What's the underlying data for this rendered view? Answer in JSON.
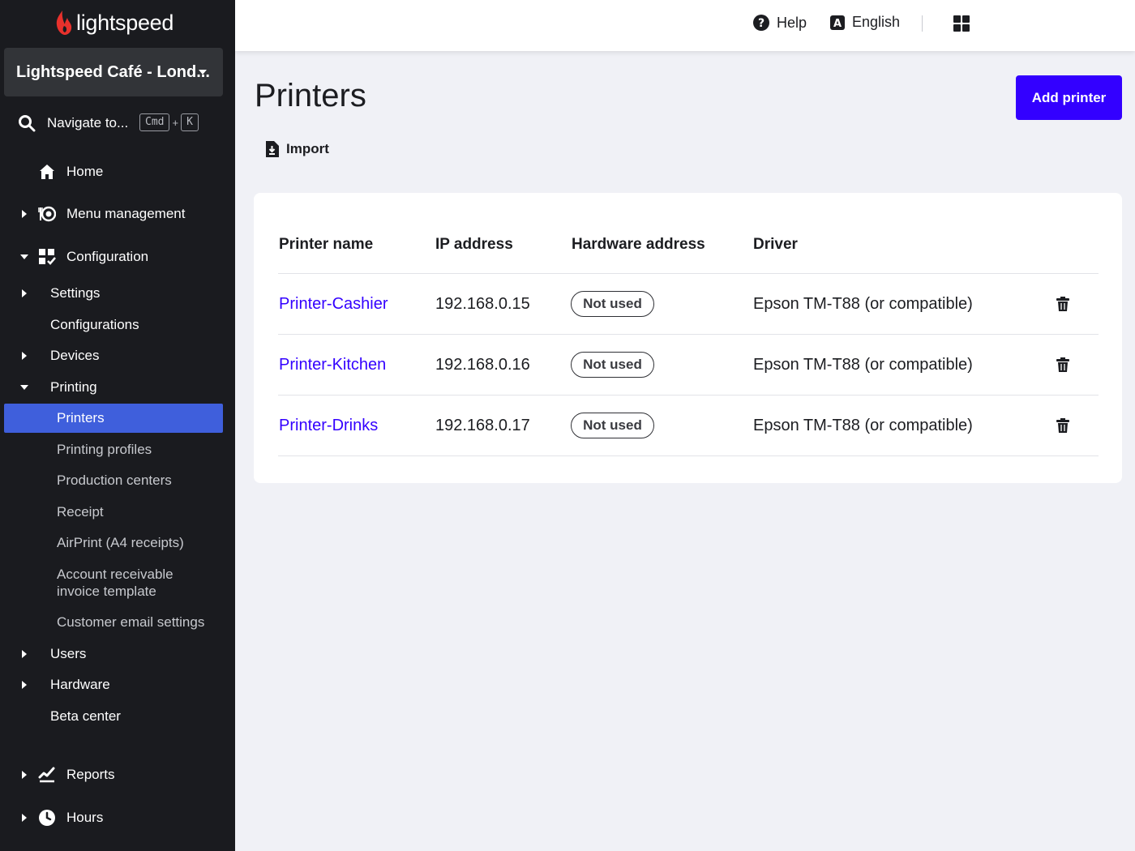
{
  "sidebar": {
    "logo_text": "lightspeed",
    "store_name": "Lightspeed Café - Lond...",
    "navigate_label": "Navigate to...",
    "shortcut_keys": [
      "Cmd",
      "K"
    ],
    "shortcut_plus": "+",
    "items": {
      "home": "Home",
      "menu_management": "Menu management",
      "configuration": "Configuration",
      "settings": "Settings",
      "configurations": "Configurations",
      "devices": "Devices",
      "printing": "Printing",
      "printers": "Printers",
      "printing_profiles": "Printing profiles",
      "production_centers": "Production centers",
      "receipt": "Receipt",
      "airprint": "AirPrint (A4 receipts)",
      "account_receivable_1": "Account receivable",
      "account_receivable_2": "invoice template",
      "customer_email": "Customer email settings",
      "users": "Users",
      "hardware": "Hardware",
      "beta_center": "Beta center",
      "reports": "Reports",
      "hours": "Hours"
    }
  },
  "topbar": {
    "help": "Help",
    "language": "English"
  },
  "main": {
    "title": "Printers",
    "add_button": "Add printer",
    "import_label": "Import",
    "columns": [
      "Printer name",
      "IP address",
      "Hardware address",
      "Driver"
    ],
    "rows": [
      {
        "name": "Printer-Cashier",
        "ip": "192.168.0.15",
        "hardware": "Not used",
        "driver": "Epson TM-T88 (or compatible)"
      },
      {
        "name": "Printer-Kitchen",
        "ip": "192.168.0.16",
        "hardware": "Not used",
        "driver": "Epson TM-T88 (or compatible)"
      },
      {
        "name": "Printer-Drinks",
        "ip": "192.168.0.17",
        "hardware": "Not used",
        "driver": "Epson TM-T88 (or compatible)"
      }
    ]
  },
  "colors": {
    "sidebar_bg": "#1a1b1f",
    "active_item": "#3f5fdc",
    "primary_button": "#3300ff",
    "link": "#3300ff",
    "logo_flame": "#e8312c"
  }
}
